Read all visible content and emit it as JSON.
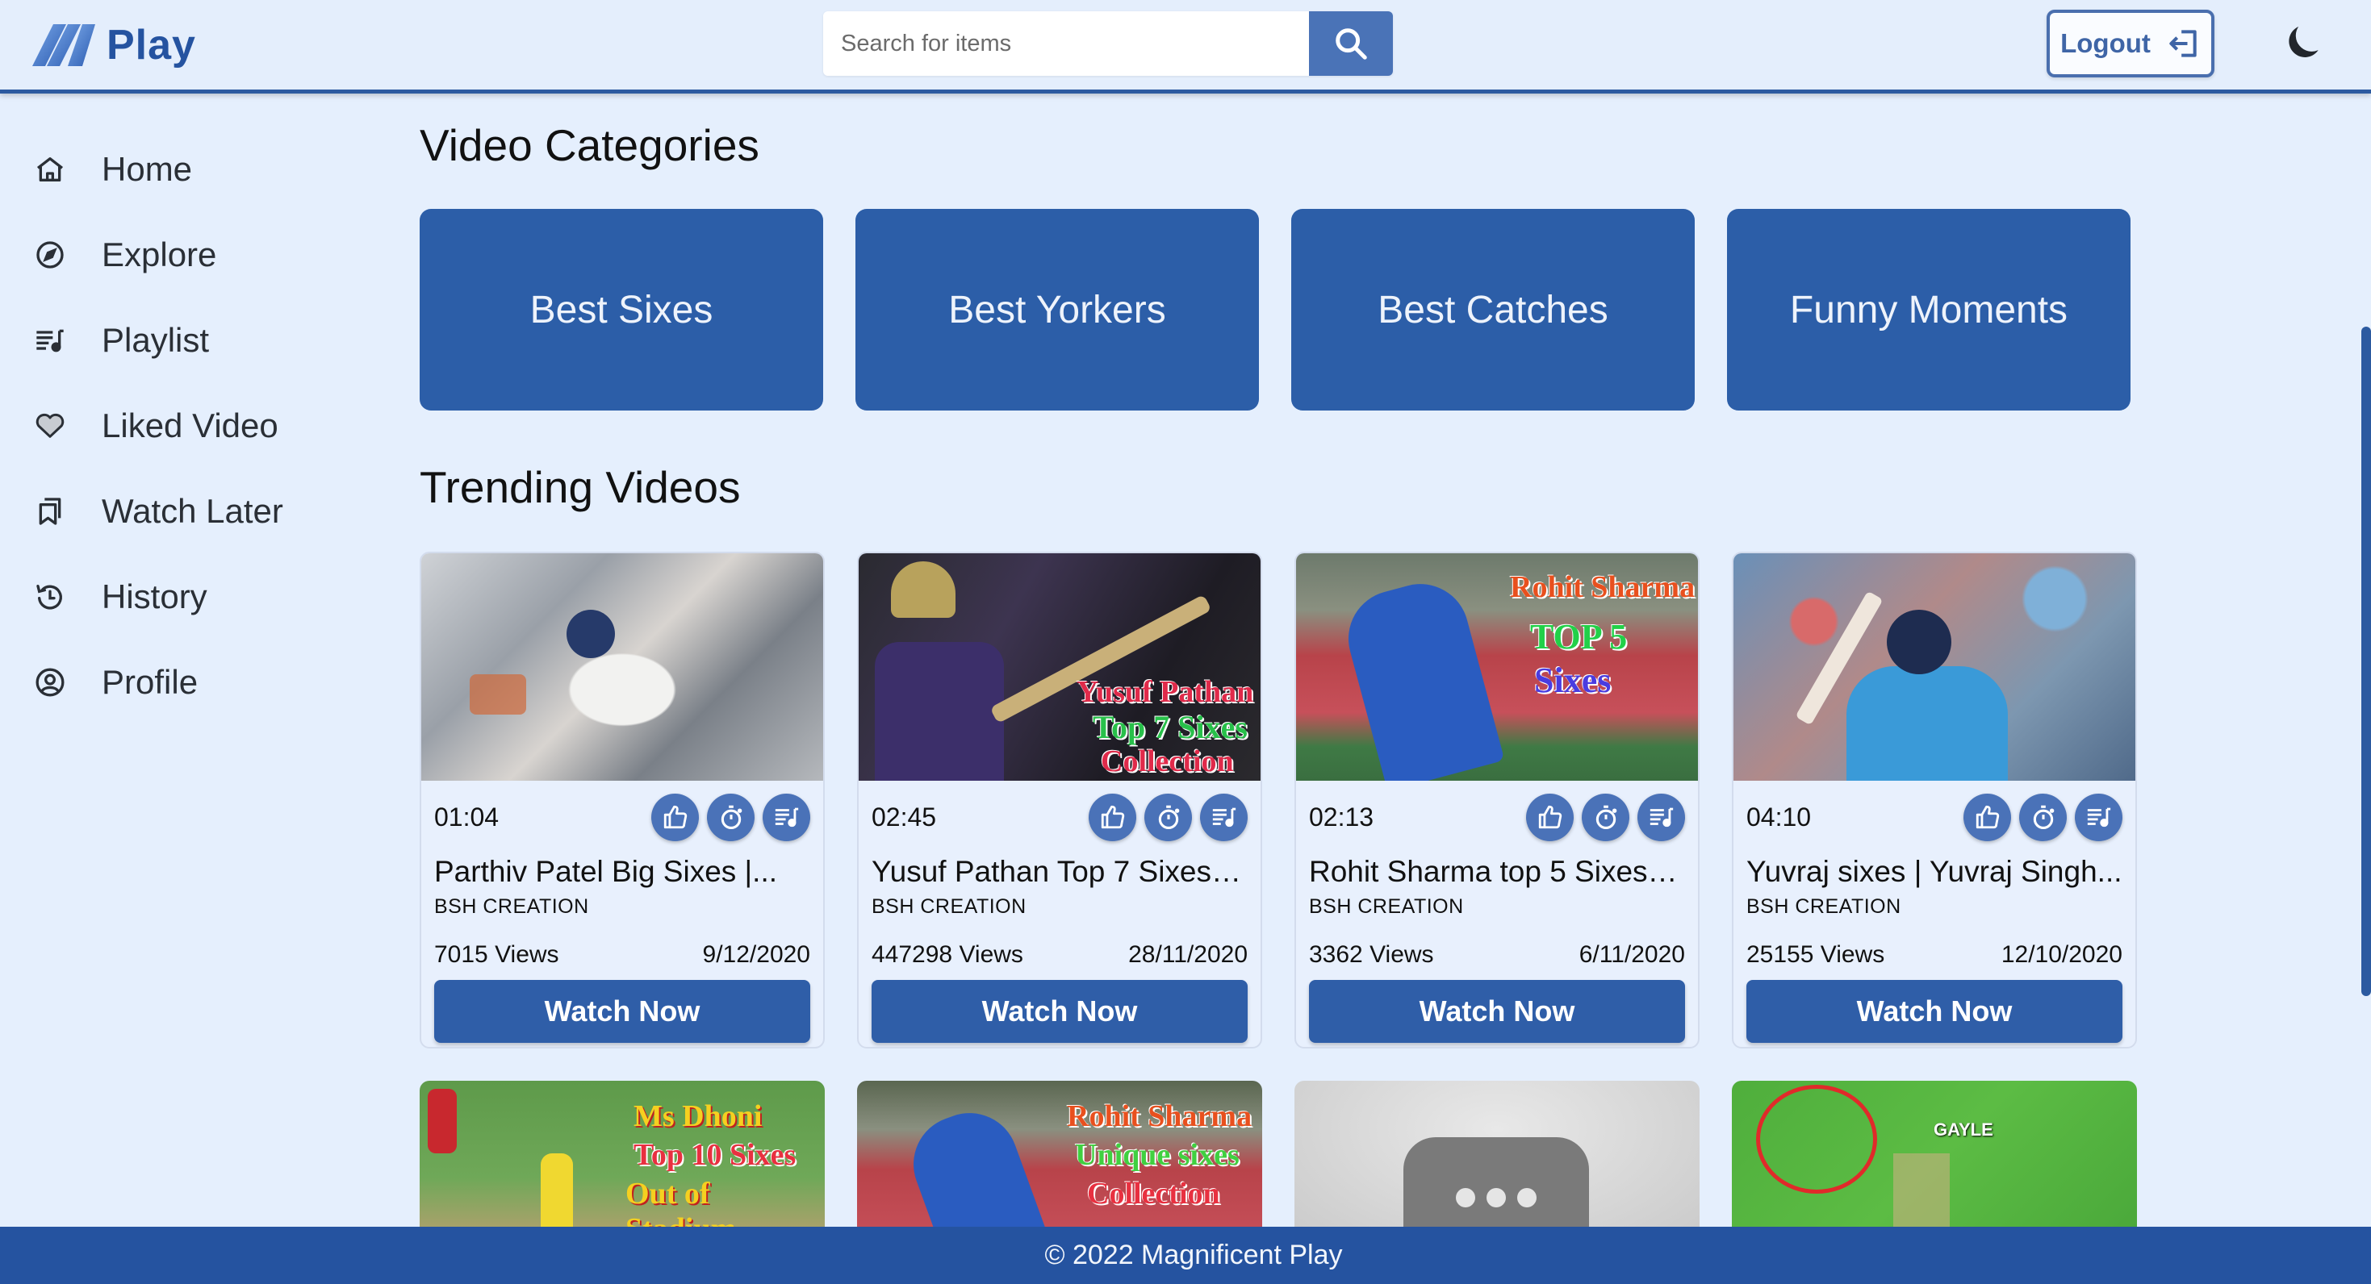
{
  "header": {
    "logo_text": "Play",
    "search": {
      "placeholder": "Search for items",
      "value": ""
    },
    "logout_label": "Logout"
  },
  "sidebar": {
    "items": [
      {
        "label": "Home",
        "icon": "home-icon"
      },
      {
        "label": "Explore",
        "icon": "compass-icon"
      },
      {
        "label": "Playlist",
        "icon": "playlist-icon"
      },
      {
        "label": "Liked Video",
        "icon": "heart-icon"
      },
      {
        "label": "Watch Later",
        "icon": "bookmark-icon"
      },
      {
        "label": "History",
        "icon": "history-icon"
      },
      {
        "label": "Profile",
        "icon": "profile-icon"
      }
    ]
  },
  "main": {
    "categories_title": "Video Categories",
    "categories": [
      "Best Sixes",
      "Best Yorkers",
      "Best Catches",
      "Funny Moments"
    ],
    "trending_title": "Trending Videos",
    "videos": [
      {
        "duration": "01:04",
        "title": "Parthiv Patel Big Sixes |...",
        "channel": "BSH CREATION",
        "views": "7015 Views",
        "date": "9/12/2020",
        "button": "Watch Now",
        "thumb_overlay": []
      },
      {
        "duration": "02:45",
        "title": "Yusuf Pathan Top 7 Sixes |...",
        "channel": "BSH CREATION",
        "views": "447298 Views",
        "date": "28/11/2020",
        "button": "Watch Now",
        "thumb_overlay": [
          "Yusuf Pathan",
          "Top 7 Sixes",
          "Collection"
        ]
      },
      {
        "duration": "02:13",
        "title": "Rohit Sharma top 5 Sixes |...",
        "channel": "BSH CREATION",
        "views": "3362 Views",
        "date": "6/11/2020",
        "button": "Watch Now",
        "thumb_overlay": [
          "Rohit Sharma",
          "TOP 5",
          "Sixes"
        ]
      },
      {
        "duration": "04:10",
        "title": "Yuvraj sixes | Yuvraj Singh...",
        "channel": "BSH CREATION",
        "views": "25155 Views",
        "date": "12/10/2020",
        "button": "Watch Now",
        "thumb_overlay": []
      }
    ],
    "videos_row2": [
      {
        "thumb_overlay": [
          "Ms  Dhoni",
          "Top 10 Sixes",
          "Out of Stadium"
        ]
      },
      {
        "thumb_overlay": [
          "Rohit Sharma",
          "Unique  sixes",
          "Collection"
        ]
      },
      {
        "thumb_overlay": []
      },
      {
        "thumb_overlay": [
          "GAYLE"
        ]
      }
    ],
    "action_icons": [
      "like-icon",
      "watch-later-icon",
      "add-to-playlist-icon"
    ]
  },
  "footer": {
    "text": "© 2022 Magnificent Play"
  },
  "colors": {
    "primary": "#2c5ea8",
    "background": "#e5effd",
    "accent": "#4a72b8"
  }
}
